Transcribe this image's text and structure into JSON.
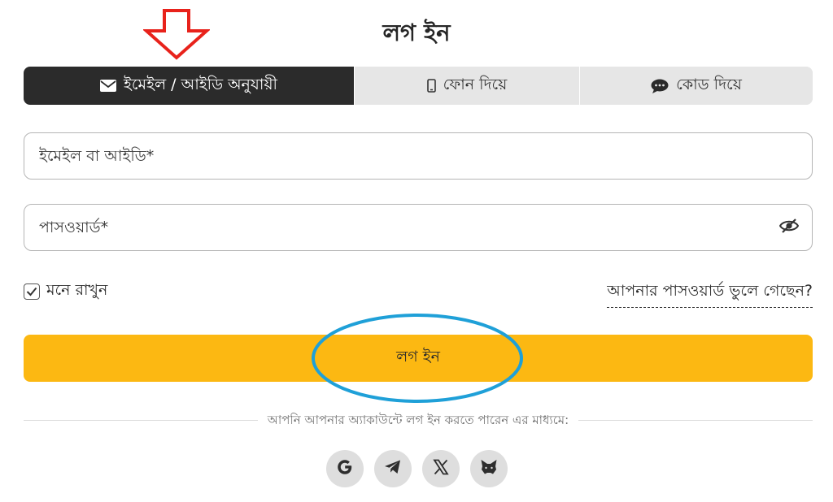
{
  "title": "লগ ইন",
  "tabs": [
    {
      "label": "ইমেইল / আইডি অনুযায়ী",
      "icon": "envelope-icon",
      "active": true
    },
    {
      "label": "ফোন দিয়ে",
      "icon": "phone-icon",
      "active": false
    },
    {
      "label": "কোড দিয়ে",
      "icon": "chat-bubble-icon",
      "active": false
    }
  ],
  "email_field": {
    "placeholder": "ইমেইল বা আইডি*",
    "value": ""
  },
  "password_field": {
    "placeholder": "পাসওয়ার্ড*",
    "value": "",
    "toggle_icon": "eye-off-icon"
  },
  "remember": {
    "label": "মনে রাখুন",
    "checked": true
  },
  "forgot_link": "আপনার পাসওয়ার্ড ভুলে গেছেন?",
  "login_button": "লগ ইন",
  "divider_text": "আপনি আপনার অ্যাকাউন্টে লগ ইন করতে পারেন এর মাধ্যমে:",
  "social": [
    {
      "name": "google",
      "icon": "google-icon"
    },
    {
      "name": "telegram",
      "icon": "telegram-icon"
    },
    {
      "name": "x",
      "icon": "x-icon"
    },
    {
      "name": "metamask",
      "icon": "metamask-icon"
    }
  ],
  "annotations": {
    "arrow_color": "#e8221b",
    "circle_color": "#1fa0d8"
  },
  "colors": {
    "accent": "#fcb812",
    "tab_active": "#2b2b2b",
    "tab_inactive": "#e6e6e6"
  }
}
